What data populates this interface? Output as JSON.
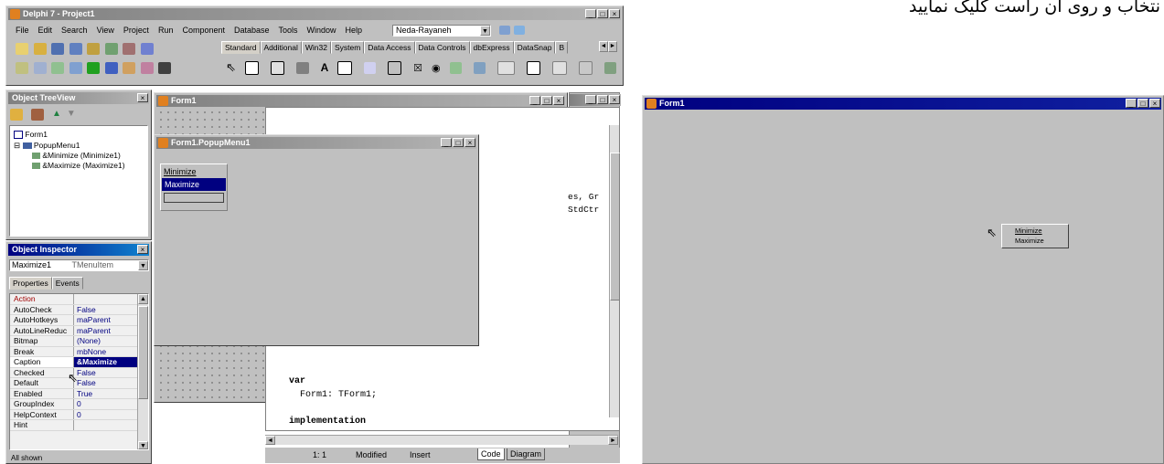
{
  "caption": "نتخاب و روی آن راست کلیک نمایید",
  "ide": {
    "title": "Delphi 7 - Project1",
    "menu": [
      "File",
      "Edit",
      "Search",
      "View",
      "Project",
      "Run",
      "Component",
      "Database",
      "Tools",
      "Window",
      "Help"
    ],
    "desktop_combo": "Neda-Rayaneh",
    "palette_tabs": [
      "Standard",
      "Additional",
      "Win32",
      "System",
      "Data Access",
      "Data Controls",
      "dbExpress",
      "DataSnap",
      "B"
    ]
  },
  "treeview": {
    "title": "Object TreeView",
    "items": [
      "Form1",
      "PopupMenu1",
      "&Minimize (Minimize1)",
      "&Maximize (Maximize1)"
    ]
  },
  "inspector": {
    "title": "Object Inspector",
    "object_name": "Maximize1",
    "object_type": "TMenuItem",
    "tabs": [
      "Properties",
      "Events"
    ],
    "rows": [
      {
        "name": "Action",
        "value": ""
      },
      {
        "name": "AutoCheck",
        "value": "False"
      },
      {
        "name": "AutoHotkeys",
        "value": "maParent"
      },
      {
        "name": "AutoLineReduc",
        "value": "maParent"
      },
      {
        "name": "Bitmap",
        "value": "(None)"
      },
      {
        "name": "Break",
        "value": "mbNone"
      },
      {
        "name": "Caption",
        "value": "&Maximize"
      },
      {
        "name": "Checked",
        "value": "False"
      },
      {
        "name": "Default",
        "value": "False"
      },
      {
        "name": "Enabled",
        "value": "True"
      },
      {
        "name": "GroupIndex",
        "value": "0"
      },
      {
        "name": "HelpContext",
        "value": "0"
      },
      {
        "name": "Hint",
        "value": ""
      }
    ],
    "footer": "All shown"
  },
  "form1": {
    "title": "Form1"
  },
  "menu_designer": {
    "title": "Form1.PopupMenu1",
    "items": [
      "Minimize",
      "Maximize"
    ]
  },
  "code": {
    "fragment1": "es, Gr",
    "fragment2": "StdCtr",
    "line_var": "var",
    "line_form": "  Form1: TForm1;",
    "line_impl": "implementation"
  },
  "statusbar": {
    "position": "1:  1",
    "state": "Modified",
    "mode": "Insert",
    "tab_code": "Code",
    "tab_diagram": "Diagram"
  },
  "runtime": {
    "title": "Form1",
    "popup_items": [
      "Minimize",
      "Maximize"
    ]
  }
}
